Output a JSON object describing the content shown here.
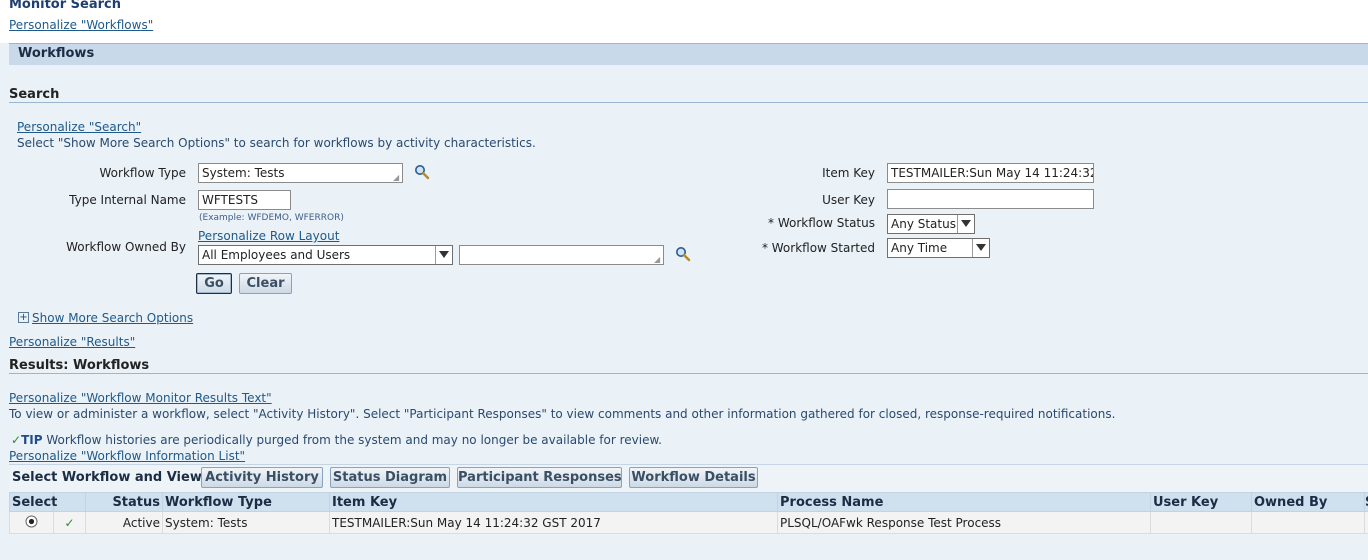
{
  "page": {
    "title": "Monitor Search",
    "personalize_workflows": "Personalize \"Workflows\"",
    "workflows_header": "Workflows"
  },
  "search": {
    "title": "Search",
    "personalize": "Personalize \"Search\"",
    "instructions": "Select \"Show More Search Options\" to search for workflows by activity characteristics.",
    "workflow_type_label": "Workflow Type",
    "workflow_type_value": "System: Tests",
    "type_internal_name_label": "Type Internal Name",
    "type_internal_name_value": "WFTESTS",
    "type_internal_name_hint": "(Example: WFDEMO, WFERROR)",
    "personalize_row_layout": "Personalize Row Layout",
    "workflow_owned_by_label": "Workflow Owned By",
    "workflow_owned_by_value": "All Employees and Users",
    "owned_by_text_value": "",
    "go_label": "Go",
    "clear_label": "Clear",
    "item_key_label": "Item Key",
    "item_key_value": "TESTMAILER:Sun May 14 11:24:32",
    "user_key_label": "User Key",
    "user_key_value": "",
    "required_marker": "*",
    "workflow_status_label": "Workflow Status",
    "workflow_status_value": "Any Status",
    "workflow_started_label": "Workflow Started",
    "workflow_started_value": "Any Time",
    "show_more_label": "Show More Search Options",
    "expand_symbol": "+"
  },
  "results": {
    "personalize": "Personalize \"Results\"",
    "title": "Results: Workflows",
    "personalize_text": "Personalize \"Workflow Monitor Results Text\"",
    "description": "To view or administer a workflow, select \"Activity History\". Select \"Participant Responses\" to view comments and other information gathered for closed, response-required notifications.",
    "tip_label": "TIP",
    "tip_text": "Workflow histories are periodically purged from the system and may no longer be available for review.",
    "personalize_list": "Personalize \"Workflow Information List\"",
    "select_view_label": "Select Workflow and View...",
    "buttons": [
      "Activity History",
      "Status Diagram",
      "Participant Responses",
      "Workflow Details"
    ],
    "columns": [
      "Select",
      "",
      "Status",
      "Workflow Type",
      "Item Key",
      "Process Name",
      "User Key",
      "Owned By",
      "S"
    ],
    "rows": [
      {
        "status": "Active",
        "workflow_type": "System: Tests",
        "item_key": "TESTMAILER:Sun May 14 11:24:32 GST 2017",
        "process_name": "PLSQL/OAFwk Response Test Process",
        "user_key": "",
        "owned_by": ""
      }
    ]
  },
  "icons": {
    "search": "magnifier-icon",
    "check": "check-icon",
    "radio": "radio-selected"
  },
  "colors": {
    "link": "#1f5a8a",
    "header_band": "#c8d9ea",
    "background": "#eaf1f7",
    "check": "#2e8b2e"
  }
}
